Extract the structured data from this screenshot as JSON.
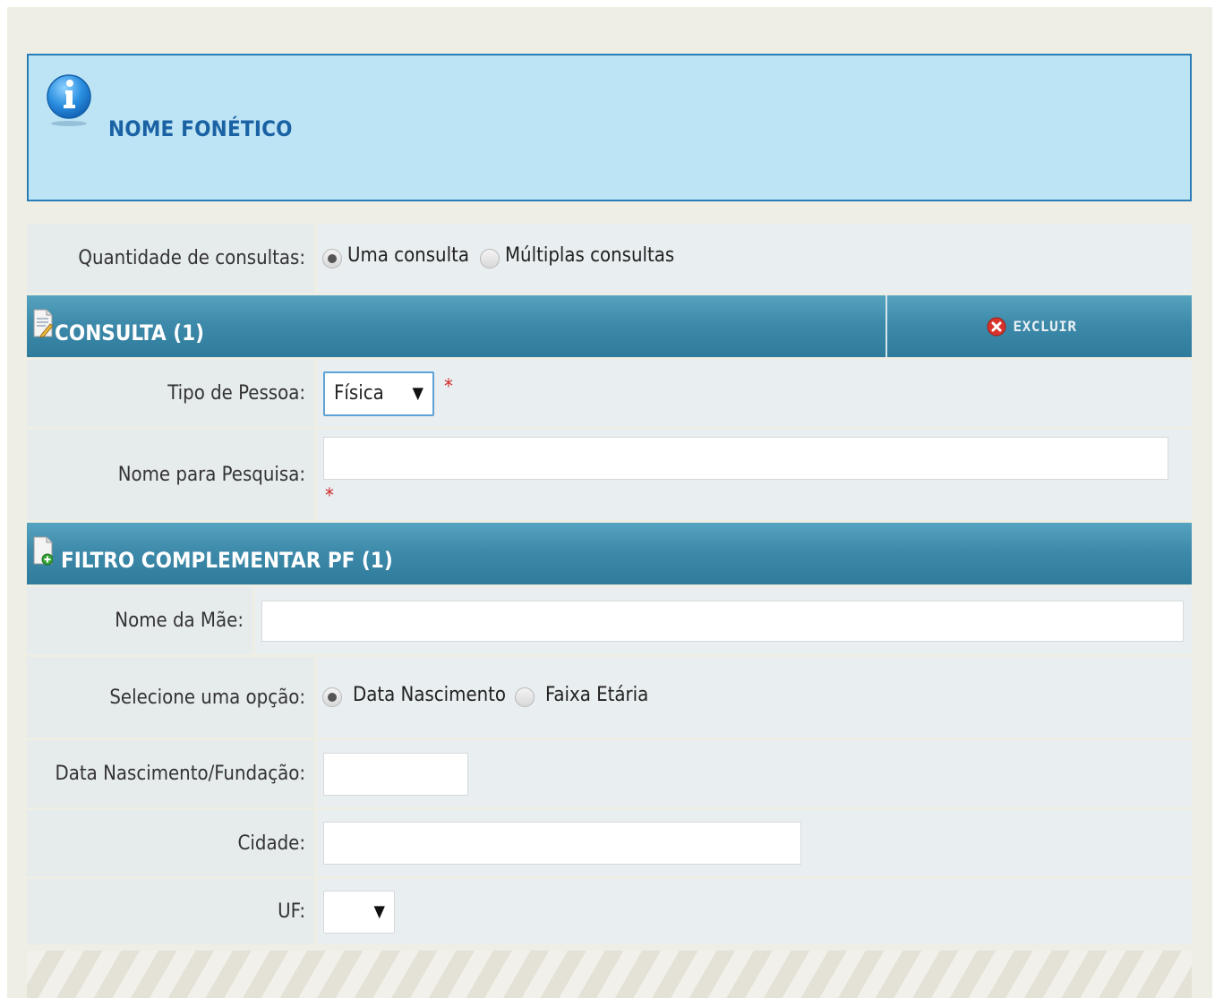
{
  "info": {
    "title": "NOME FONÉTICO",
    "icon": "info-icon"
  },
  "quantidade": {
    "label": "Quantidade de consultas:",
    "options": [
      "Uma consulta",
      "Múltiplas consultas"
    ],
    "selected": "Uma consulta"
  },
  "consulta": {
    "title": "CONSULTA (1)",
    "delete_label": "EXCLUIR",
    "tipo_pessoa": {
      "label": "Tipo de Pessoa:",
      "value": "Física",
      "required_mark": "*"
    },
    "nome_pesquisa": {
      "label": "Nome para Pesquisa:",
      "value": "",
      "required_mark": "*"
    }
  },
  "filtro": {
    "title": "FILTRO COMPLEMENTAR PF (1)",
    "nome_mae": {
      "label": "Nome da Mãe:",
      "value": ""
    },
    "opcao": {
      "label": "Selecione uma opção:",
      "options": [
        "Data Nascimento",
        "Faixa Etária"
      ],
      "selected": "Data Nascimento"
    },
    "data_nascimento": {
      "label": "Data Nascimento/Fundação:",
      "value": ""
    },
    "cidade": {
      "label": "Cidade:",
      "value": ""
    },
    "uf": {
      "label": "UF:",
      "value": ""
    }
  },
  "colors": {
    "info_bg": "#bde4f5",
    "info_border": "#2a7db6",
    "header_bar": "#3e8aaa",
    "required": "#d12a2a"
  }
}
